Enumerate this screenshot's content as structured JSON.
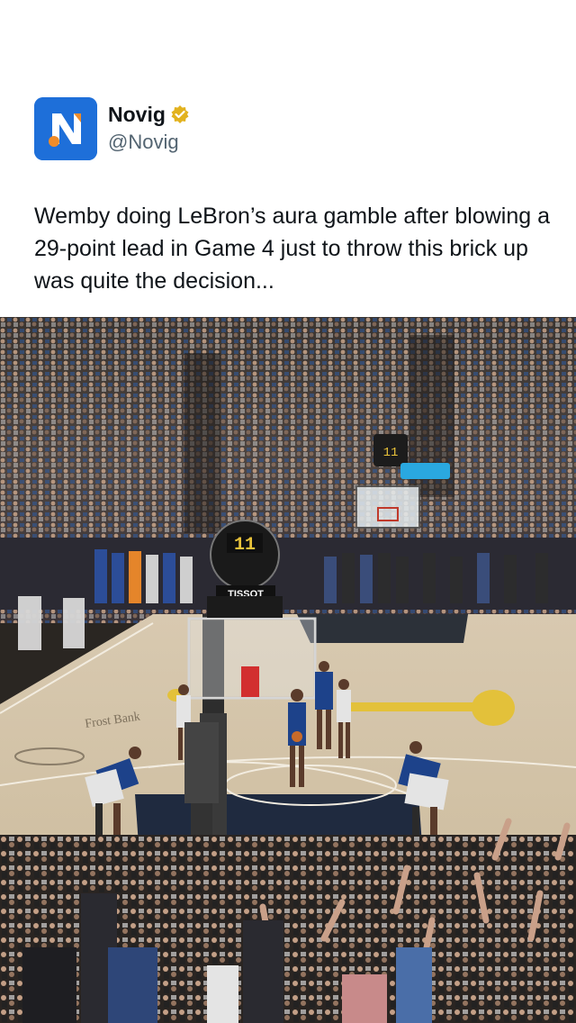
{
  "post": {
    "author": {
      "display_name": "Novig",
      "handle": "@Novig",
      "verified": true,
      "verified_badge_color": "#e2b21f",
      "avatar_icon": "novig-logo-icon",
      "avatar_color": "#1e6fd9",
      "avatar_letter": "N",
      "logo_accent_color": "#f08c2a"
    },
    "text": "Wemby doing LeBron’s aura gamble after blowing a 29-point lead in Game 4 just to throw this brick up was quite the decision...",
    "media": {
      "type": "photo",
      "shot_clock_text": "11",
      "sponsor_text": "TISSOT"
    }
  }
}
